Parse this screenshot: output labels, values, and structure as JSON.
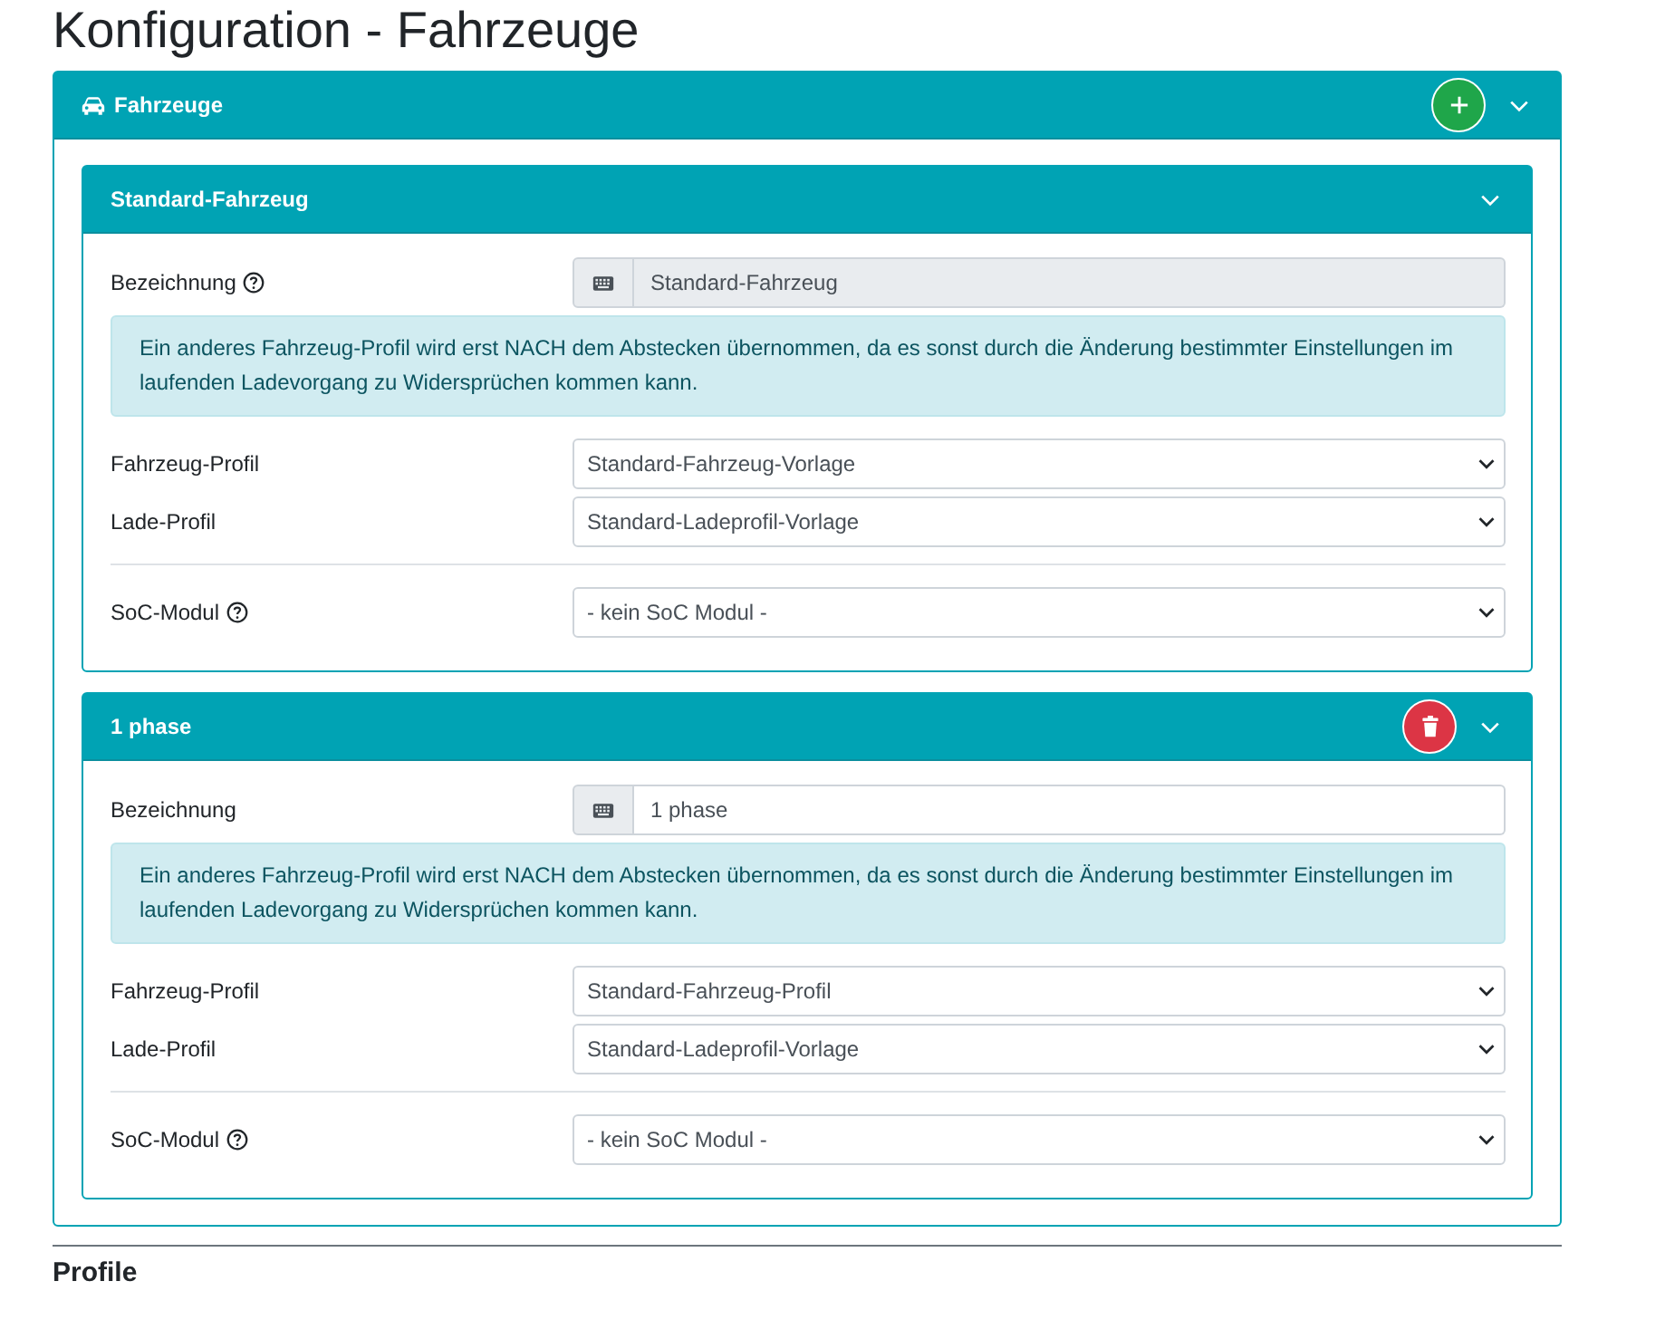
{
  "page_title": "Konfiguration - Fahrzeuge",
  "section": {
    "title": "Fahrzeuge",
    "header_buttons": [
      {
        "kind": "add"
      }
    ],
    "vehicles": [
      {
        "title": "Standard-Fahrzeug",
        "name_label": "Bezeichnung",
        "name_help": true,
        "name_value": "Standard-Fahrzeug",
        "name_disabled": true,
        "notice": "Ein anderes Fahrzeug-Profil wird erst NACH dem Abstecken übernommen, da es sonst durch die Änderung bestimmter Einstellungen im laufenden Ladevorgang zu Widersprüchen kommen kann.",
        "selects": [
          {
            "label": "Fahrzeug-Profil",
            "value": "Standard-Fahrzeug-Vorlage"
          },
          {
            "label": "Lade-Profil",
            "value": "Standard-Ladeprofil-Vorlage"
          }
        ],
        "soc": {
          "label": "SoC-Modul",
          "help": true,
          "value": "- kein SoC Modul -"
        }
      },
      {
        "title": "1 phase",
        "header_buttons": [
          {
            "kind": "delete"
          }
        ],
        "name_label": "Bezeichnung",
        "name_help": false,
        "name_value": "1 phase",
        "name_disabled": false,
        "notice": "Ein anderes Fahrzeug-Profil wird erst NACH dem Abstecken übernommen, da es sonst durch die Änderung bestimmter Einstellungen im laufenden Ladevorgang zu Widersprüchen kommen kann.",
        "selects": [
          {
            "label": "Fahrzeug-Profil",
            "value": "Standard-Fahrzeug-Profil"
          },
          {
            "label": "Lade-Profil",
            "value": "Standard-Ladeprofil-Vorlage"
          }
        ],
        "soc": {
          "label": "SoC-Modul",
          "help": true,
          "value": "- kein SoC Modul -"
        }
      }
    ]
  },
  "next_heading": "Profile"
}
